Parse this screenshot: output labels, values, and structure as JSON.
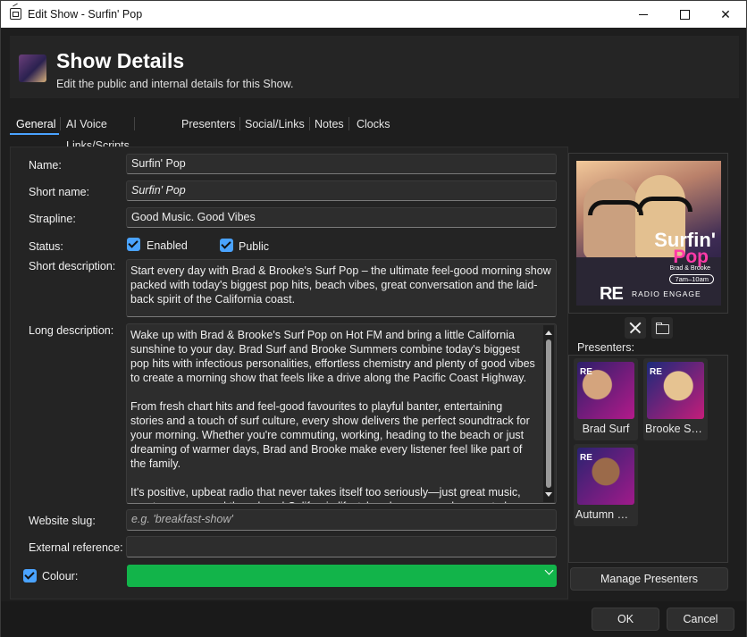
{
  "window": {
    "title": "Edit Show - Surfin' Pop"
  },
  "header": {
    "title": "Show Details",
    "subtitle": "Edit the public and internal details for this Show."
  },
  "tabs": [
    {
      "label": "General",
      "active": true
    },
    {
      "label": "AI Voice Links/Scripts"
    },
    {
      "label": "Presenters"
    },
    {
      "label": "Social/Links"
    },
    {
      "label": "Notes"
    },
    {
      "label": "Clocks"
    }
  ],
  "form": {
    "name_label": "Name:",
    "name_value": "Surfin' Pop",
    "short_name_label": "Short name:",
    "short_name_value": "Surfin' Pop",
    "strapline_label": "Strapline:",
    "strapline_value": "Good Music. Good Vibes",
    "status_label": "Status:",
    "enabled_label": "Enabled",
    "enabled_checked": true,
    "public_label": "Public",
    "public_checked": true,
    "short_description_label": "Short description:",
    "short_description_value": "Start every day with Brad & Brooke's Surf Pop – the ultimate feel-good morning show packed with today's biggest pop hits, beach vibes, great conversation and the laid-back spirit of the California coast.",
    "long_description_label": "Long description:",
    "long_description_value": "Wake up with Brad & Brooke's Surf Pop on Hot FM and bring a little California sunshine to your day. Brad Surf and Brooke Summers combine today's biggest pop hits with infectious personalities, effortless chemistry and plenty of good vibes to create a morning show that feels like a drive along the Pacific Coast Highway.\n\nFrom fresh chart hits and feel-good favourites to playful banter, entertaining stories and a touch of surf culture, every show delivers the perfect soundtrack for your morning. Whether you're commuting, working, heading to the beach or just dreaming of warmer days, Brad and Brooke make every listener feel like part of the family.\n\nIt's positive, upbeat radio that never takes itself too seriously—just great music, great company and the relaxed California lifestyle, wherever you happen to be. Catch the show every weekday morning on Hot FM with Brad & Brooke's Surf Pop.",
    "website_slug_label": "Website slug:",
    "website_slug_placeholder": "e.g. 'breakfast-show'",
    "external_reference_label": "External reference:",
    "external_reference_value": "",
    "colour_label": "Colour:",
    "colour_checked": true,
    "colour_value": "#12b44a"
  },
  "artwork": {
    "title_line1": "Surfin'",
    "title_line2": "Pop",
    "subtitle": "Brad & Brooke",
    "time": "7am–10am",
    "logo": "RE",
    "brand": "RADIO ENGAGE"
  },
  "presenters": {
    "label": "Presenters:",
    "items": [
      {
        "name": "Brad Surf"
      },
      {
        "name": "Brooke Summers"
      },
      {
        "name": "Autumn Rose"
      }
    ],
    "manage_label": "Manage Presenters"
  },
  "footer": {
    "ok_label": "OK",
    "cancel_label": "Cancel"
  }
}
